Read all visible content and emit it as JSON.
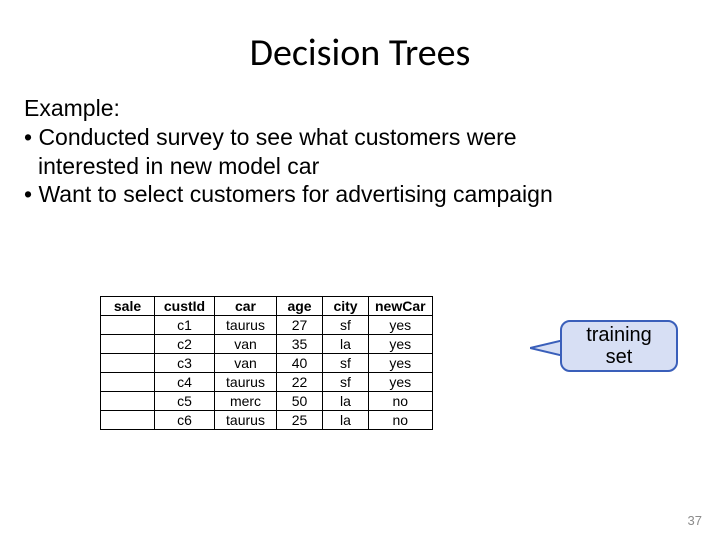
{
  "title": "Decision Trees",
  "example_label": "Example:",
  "bullet1a": "• Conducted survey to see what customers were",
  "bullet1b": "interested in new model car",
  "bullet2": "• Want to select customers for advertising campaign",
  "callout_line1": "training",
  "callout_line2": "set",
  "page_number": "37",
  "chart_data": {
    "type": "table",
    "columns": [
      "sale",
      "custId",
      "car",
      "age",
      "city",
      "newCar"
    ],
    "rows": [
      {
        "sale": "",
        "custId": "c1",
        "car": "taurus",
        "age": 27,
        "city": "sf",
        "newCar": "yes"
      },
      {
        "sale": "",
        "custId": "c2",
        "car": "van",
        "age": 35,
        "city": "la",
        "newCar": "yes"
      },
      {
        "sale": "",
        "custId": "c3",
        "car": "van",
        "age": 40,
        "city": "sf",
        "newCar": "yes"
      },
      {
        "sale": "",
        "custId": "c4",
        "car": "taurus",
        "age": 22,
        "city": "sf",
        "newCar": "yes"
      },
      {
        "sale": "",
        "custId": "c5",
        "car": "merc",
        "age": 50,
        "city": "la",
        "newCar": "no"
      },
      {
        "sale": "",
        "custId": "c6",
        "car": "taurus",
        "age": 25,
        "city": "la",
        "newCar": "no"
      }
    ]
  }
}
